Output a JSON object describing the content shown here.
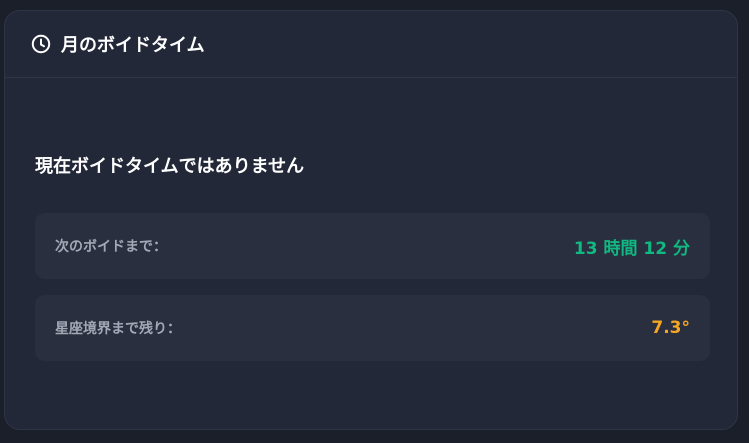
{
  "header": {
    "icon": "clock-icon",
    "title": "月のボイドタイム"
  },
  "status": {
    "text": "現在ボイドタイムではありません"
  },
  "rows": [
    {
      "label": "次のボイドまで：",
      "value": "13 時間 12 分",
      "color": "#10b981"
    },
    {
      "label": "星座境界まで残り：",
      "value": "7.3°",
      "color": "#f5a623"
    }
  ]
}
